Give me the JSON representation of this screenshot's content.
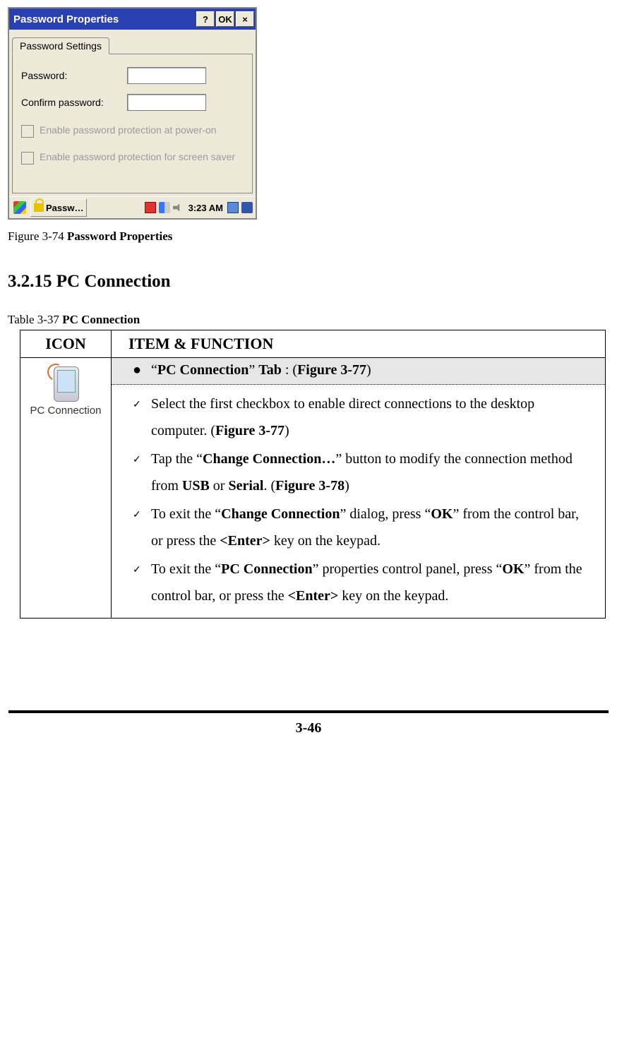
{
  "dialog": {
    "title": "Password Properties",
    "help_btn": "?",
    "ok_btn": "OK",
    "close_btn": "×",
    "tab_label": "Password Settings",
    "password_label": "Password:",
    "confirm_label": "Confirm password:",
    "cb1": "Enable password protection at power-on",
    "cb2": "Enable password protection for screen saver"
  },
  "taskbar": {
    "app_label": "Passw…",
    "clock": "3:23 AM"
  },
  "figure_caption": {
    "prefix": "Figure 3-74 ",
    "title": "Password Properties"
  },
  "section_heading": "3.2.15 PC Connection",
  "table_caption": {
    "prefix": "Table 3-37 ",
    "title": "PC Connection"
  },
  "table": {
    "header_icon": "ICON",
    "header_item": "ITEM & FUNCTION",
    "icon_label": "PC Connection",
    "tab_line": {
      "q1": "“",
      "name": "PC Connection",
      "q2": "” ",
      "tab_word": "Tab",
      "after": " : (",
      "fig": "Figure 3-77",
      "close": ")"
    },
    "items": [
      {
        "segments": [
          {
            "t": "Select the first checkbox to enable direct connections to the desktop computer. ("
          },
          {
            "t": "Figure 3-77",
            "b": true
          },
          {
            "t": ")"
          }
        ]
      },
      {
        "segments": [
          {
            "t": "Tap the “"
          },
          {
            "t": "Change Connection…",
            "b": true
          },
          {
            "t": "” button to modify the connection method from "
          },
          {
            "t": "USB",
            "b": true
          },
          {
            "t": " or "
          },
          {
            "t": "Serial",
            "b": true
          },
          {
            "t": ". ("
          },
          {
            "t": "Figure 3-78",
            "b": true
          },
          {
            "t": ")"
          }
        ]
      },
      {
        "segments": [
          {
            "t": "To exit the “"
          },
          {
            "t": "Change Connection",
            "b": true
          },
          {
            "t": "” dialog, press “"
          },
          {
            "t": "OK",
            "b": true
          },
          {
            "t": "” from the control bar, or press the "
          },
          {
            "t": "<Enter>",
            "b": true
          },
          {
            "t": " key on the keypad."
          }
        ]
      },
      {
        "segments": [
          {
            "t": "To exit the “"
          },
          {
            "t": "PC Connection",
            "b": true
          },
          {
            "t": "” properties control panel, press “"
          },
          {
            "t": "OK",
            "b": true
          },
          {
            "t": "” from the control bar, or press the "
          },
          {
            "t": "<Enter>",
            "b": true
          },
          {
            "t": " key on the keypad."
          }
        ]
      }
    ]
  },
  "page_number": "3-46"
}
